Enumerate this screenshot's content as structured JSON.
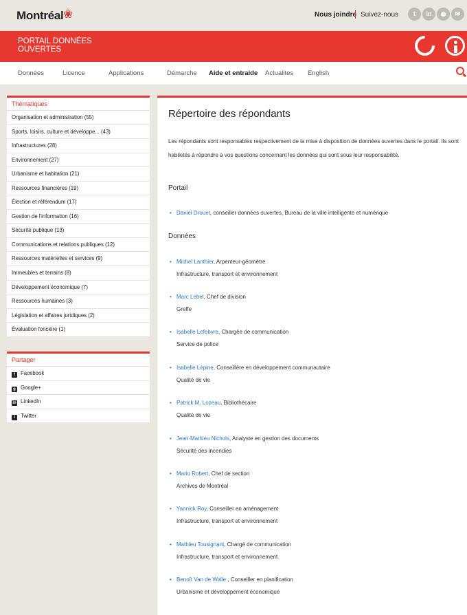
{
  "header": {
    "logo": "Montréal",
    "contact": "Nous joindre",
    "follow": "Suivez-nous",
    "social_icons": [
      "twitter-icon",
      "linkedin-icon",
      "rss-icon",
      "mail-icon"
    ]
  },
  "banner": {
    "title": "PORTAIL DONNÉES OUVERTES"
  },
  "nav": {
    "items": [
      "Données",
      "Licence",
      "Applications",
      "Démarche",
      "Aide et entraide",
      "Actualites",
      "English"
    ],
    "active": "Aide et entraide"
  },
  "sidebar": {
    "themes_title": "Thématiques",
    "themes": [
      "Organisation et administration (55)",
      "Sports, loisirs, culture et développe... (43)",
      "Infrastructures (28)",
      "Environnement (27)",
      "Urbanisme et habitation (21)",
      "Ressources financières (19)",
      "Élection et référendum (17)",
      "Gestion de l'information (16)",
      "Sécurité publique (13)",
      "Communications et relations publiques (12)",
      "Ressources matérielles et services (9)",
      "Immeubles et terrains (8)",
      "Développement économique (7)",
      "Ressources humaines (3)",
      "Législation et affaires juridiques (2)",
      "Évaluation foncière (1)"
    ],
    "share_title": "Partager",
    "share": [
      "Facebook",
      "Google+",
      "LinkedIn",
      "Twitter"
    ]
  },
  "main": {
    "title": "Répertoire des répondants",
    "intro": "Les répondants sont responsables respectivement de la mise à disposition de données ouvertes dans le portail. Ils sont habiletés à répondre à vos questions concernant les données qui sont sous leur responsabilité.",
    "portail_heading": "Portail",
    "portail": [
      {
        "name": "Daniel Drouet",
        "role": ", conseiller données ouvertes, Bureau de la ville intelligente et numérique",
        "unit": ""
      }
    ],
    "donnees_heading": "Données",
    "donnees": [
      {
        "name": "Michel Lanthier",
        "role": ", Arpenteur-géomètre",
        "unit": "Infrastructure, transport et environnement"
      },
      {
        "name": "Marc Lebel",
        "role": ", Chef de division",
        "unit": "Greffe"
      },
      {
        "name": "Isabelle Lefebvre",
        "role": ", Chargée de communication",
        "unit": "Service de police"
      },
      {
        "name": "Isabelle Lépine",
        "role": ", Conseillère en développement communautaire",
        "unit": "Qualité de vie"
      },
      {
        "name": "Patrick M. Lozeau",
        "role": ", Bibliothécaire",
        "unit": "Qualité de vie"
      },
      {
        "name": "Jean-Mathieu Nichols",
        "role": ", Analyste en gestion des documents",
        "unit": "Sécurité des incendies"
      },
      {
        "name": "Mario Robert",
        "role": ", Chef de section",
        "unit": "Archives de Montréal"
      },
      {
        "name": "Yannick Roy",
        "role": ", Conseiller en aménagement",
        "unit": "Infrastructure, transport et environnement"
      },
      {
        "name": "Mathieu Tousignant",
        "role": ", Chargé de communication",
        "unit": "Infrastructure, transport et environnement"
      },
      {
        "name": "Benoît Van de Walle",
        "role": " , Conseiller en planification",
        "unit": "Urbanisme et développement économique"
      }
    ]
  }
}
